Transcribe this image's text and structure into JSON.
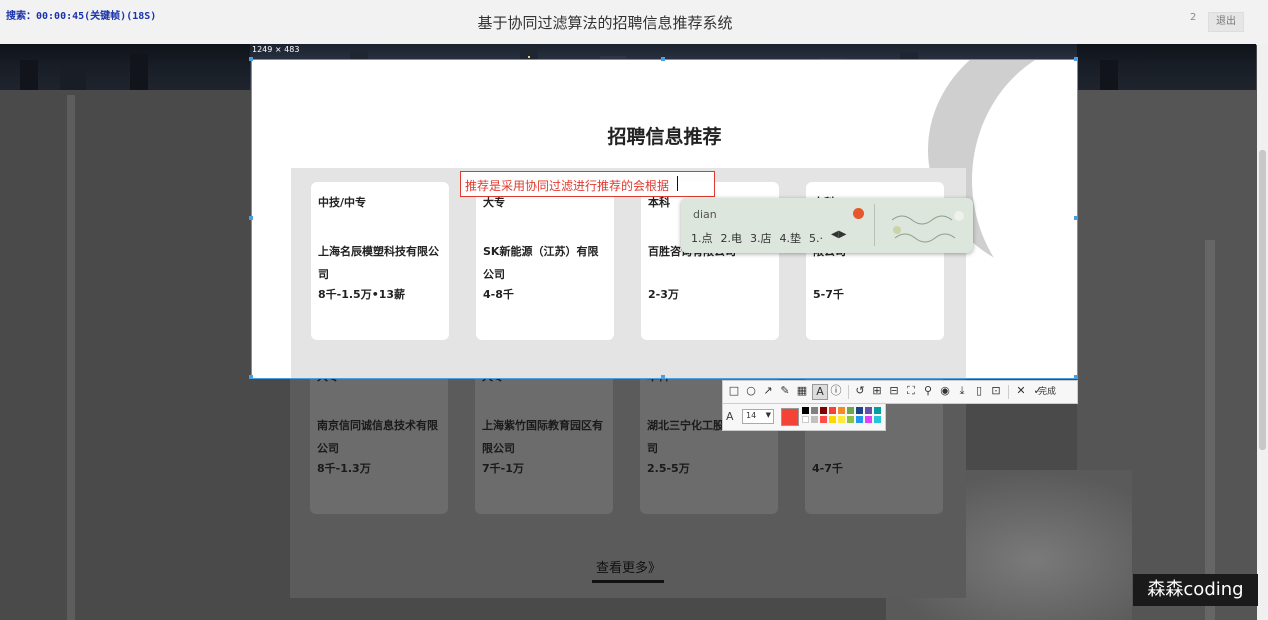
{
  "header": {
    "title": "基于协同过滤算法的招聘信息推荐系统",
    "recording_status": "搜索：00:00:45(关键帧)(18S)",
    "user_count": "2",
    "logout_label": "退出"
  },
  "selection": {
    "size_label": "1249 × 483"
  },
  "section": {
    "title": "招聘信息推荐",
    "more_label": "查看更多》"
  },
  "jobs_top": [
    {
      "education": "中技/中专",
      "company": "上海名辰模塑科技有限公司",
      "salary": "8千-1.5万•13薪"
    },
    {
      "education": "大专",
      "company": "SK新能源（江苏）有限公司",
      "salary": "4-8千"
    },
    {
      "education": "本科",
      "company": "百胜咨询有限公司",
      "salary": "2-3万"
    },
    {
      "education": "本科",
      "company": "限公司",
      "salary": "5-7千"
    }
  ],
  "jobs_bottom": [
    {
      "education": "大专",
      "company": "南京信同诚信息技术有限公司",
      "salary": "8千-1.3万"
    },
    {
      "education": "大专",
      "company": "上海紫竹国际教育园区有限公司",
      "salary": "7千-1万"
    },
    {
      "education": "本科",
      "company": "湖北三宁化工股份有限公司",
      "salary": "2.5-5万"
    },
    {
      "education": "",
      "company": "有限公司",
      "salary": "4-7千"
    }
  ],
  "annotation": {
    "text": "推荐是采用协同过滤进行推荐的会根据"
  },
  "ime": {
    "input": "dian",
    "candidates": [
      "1.点",
      "2.电",
      "3.店",
      "4.垫",
      "5.·"
    ]
  },
  "toolbar": {
    "icons": [
      "rectangle-icon",
      "ellipse-icon",
      "arrow-icon",
      "pencil-icon",
      "mosaic-icon",
      "text-icon",
      "number-icon",
      "undo-icon",
      "ocr-icon",
      "translate-icon",
      "screenshot-icon",
      "pin-icon",
      "record-icon",
      "download-icon",
      "save-icon",
      "bookmark-icon",
      "close-icon",
      "confirm-icon"
    ],
    "done_label": "完成",
    "font_size": "14",
    "current_color": "#f44336",
    "palette": [
      "#000000",
      "#808080",
      "#800000",
      "#f44336",
      "#f28c28",
      "#6aa84f",
      "#1c4587",
      "#674ea7",
      "#00a0a0",
      "#ffffff",
      "#c0c0c0",
      "#ff4b4b",
      "#ffd700",
      "#ffeb3b",
      "#8bc34a",
      "#2196f3",
      "#e040fb",
      "#26c6da"
    ]
  },
  "watermark": "森森coding"
}
